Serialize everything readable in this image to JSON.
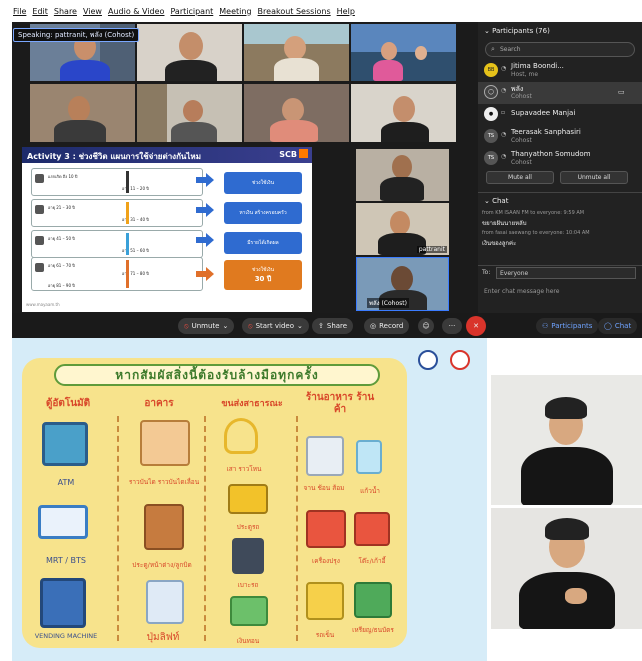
{
  "menu": [
    "File",
    "Edit",
    "Share",
    "View",
    "Audio & Video",
    "Participant",
    "Meeting",
    "Breakout Sessions",
    "Help"
  ],
  "speaking": "Speaking: pattranit, พลัง (Cohost)",
  "slide": {
    "title": "Activity 3 : ช่วงชีวิต แผนการใช้จ่ายต่างกันไหม",
    "brand": "SCB",
    "rows": [
      {
        "left": "แรกเกิด ถึง 10 ปี",
        "right": "อายุ 11 – 20 ปี"
      },
      {
        "left": "อายุ 21 – 30 ปี",
        "right": "อายุ 31 – 40 ปี"
      },
      {
        "left": "อายุ 41 – 50 ปี",
        "right": "อายุ 51 – 60 ปี"
      },
      {
        "left": "อายุ 61 – 70 ปี",
        "right": "อายุ 71 – 80 ปี"
      },
      {
        "left": "อายุ 81 – 90 ปี",
        "right": ""
      }
    ],
    "boxes": [
      "ช่วงใช้เงิน",
      "หาเงิน สร้างครอบครัว",
      "มีรายได้เกิดผล",
      "ช่วงใช้เงิน"
    ],
    "box_extra": "30 ปี",
    "footer": "www.mayaam.th"
  },
  "self_tiles": [
    {
      "name": ""
    },
    {
      "name": "pattranit"
    },
    {
      "name": "พลัง (Cohost)"
    }
  ],
  "participants": {
    "header": "Participants (76)",
    "search_placeholder": "Search",
    "list": [
      {
        "initials": "BB",
        "name": "Jitima Boondi...",
        "role": "Host, me",
        "color": "#e6c21a"
      },
      {
        "initials": "",
        "name": "พลัง",
        "role": "Cohost",
        "color": "#555"
      },
      {
        "initials": "",
        "name": "Supavadee Manjai",
        "role": "Cohost",
        "color": "#eee"
      },
      {
        "initials": "TS",
        "name": "Teerasak Sanphasiri",
        "role": "Cohost",
        "color": "#555"
      },
      {
        "initials": "TS",
        "name": "Thanyathon Somudom",
        "role": "Cohost",
        "color": "#555"
      }
    ],
    "mute_all": "Mute all",
    "unmute_all": "Unmute all"
  },
  "chat": {
    "header": "Chat",
    "messages": [
      {
        "from": "from KM ISAAN FM to everyone:  9:59 AM",
        "text": "ขยายฝันนายหลับ"
      },
      {
        "from": "from fasai saewang to everyone:  10:04 AM",
        "text": "เงินของลูกค่ะ"
      }
    ],
    "to_label": "To:",
    "to_value": "Everyone",
    "input_placeholder": "Enter chat message here"
  },
  "toolbar": {
    "unmute": "Unmute",
    "start_video": "Start video",
    "share": "Share",
    "record": "Record",
    "participants": "Participants",
    "chat": "Chat"
  },
  "poster": {
    "headline": "หากสัมผัสสิ่งนี้ต้องรับล้างมือทุกครั้ง",
    "columns": [
      "ตู้อัตโนมัติ",
      "อาคาร",
      "ขนส่งสาธารณะ",
      "ร้านอาหาร ร้านค้า"
    ],
    "col1": [
      "ATM",
      "MRT / BTS",
      "VENDING MACHINE"
    ],
    "col2": [
      "ราวบันได ราวบันไดเลื่อน",
      "ประตู/หน้าต่าง/ลูกบิด",
      "ปุ่มลิฟท์"
    ],
    "col3": [
      "เสา ราวโหน",
      "ประตูรถ",
      "เบาะรถ",
      "เงินทอน"
    ],
    "col4": [
      "จาน ช้อน ส้อม",
      "แก้วน้ำ",
      "เครื่องปรุง",
      "โต๊ะ/เก้าอี้",
      "รถเข็น",
      "เหรียญ/ธนบัตร"
    ]
  },
  "colors": {
    "accent": "#2f6bd0",
    "leave": "#d9342b",
    "poster_bg": "#f7e38c"
  }
}
